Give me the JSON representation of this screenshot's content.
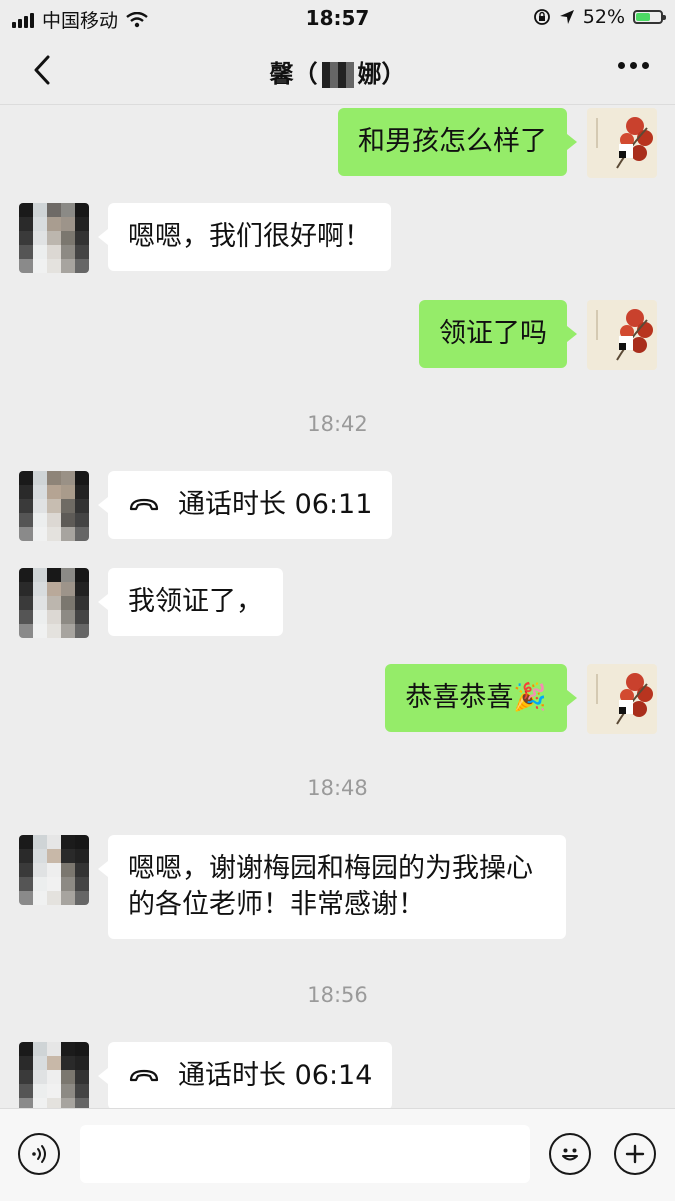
{
  "status_bar": {
    "carrier": "中国移动",
    "time": "18:57",
    "battery_percent": "52%",
    "battery_level": 0.52
  },
  "nav": {
    "title_prefix": "馨（",
    "title_name": "娜）",
    "back_icon": "chevron-left-icon",
    "more_icon": "more-icon"
  },
  "messages": [
    {
      "side": "me",
      "text": "和男孩怎么样了"
    },
    {
      "side": "other",
      "text": "嗯嗯，我们很好啊！"
    },
    {
      "side": "me",
      "text": "领证了吗"
    },
    {
      "type": "time",
      "text": "18:42"
    },
    {
      "side": "other",
      "type": "call",
      "text": "通话时长 06:11"
    },
    {
      "side": "other",
      "text": "我领证了，"
    },
    {
      "side": "me",
      "text": "恭喜恭喜",
      "emoji": "🎉"
    },
    {
      "type": "time",
      "text": "18:48"
    },
    {
      "side": "other",
      "text": "嗯嗯，谢谢梅园和梅园的为我操心的各位老师！非常感谢！"
    },
    {
      "type": "time",
      "text": "18:56"
    },
    {
      "side": "other",
      "type": "call",
      "text": "通话时长 06:14"
    }
  ],
  "input_bar": {
    "voice_icon": "voice-icon",
    "emoji_icon": "emoji-icon",
    "add_icon": "plus-icon",
    "input_value": ""
  },
  "colors": {
    "my_bubble": "#95ec69",
    "other_bubble": "#ffffff",
    "background": "#ededed"
  }
}
